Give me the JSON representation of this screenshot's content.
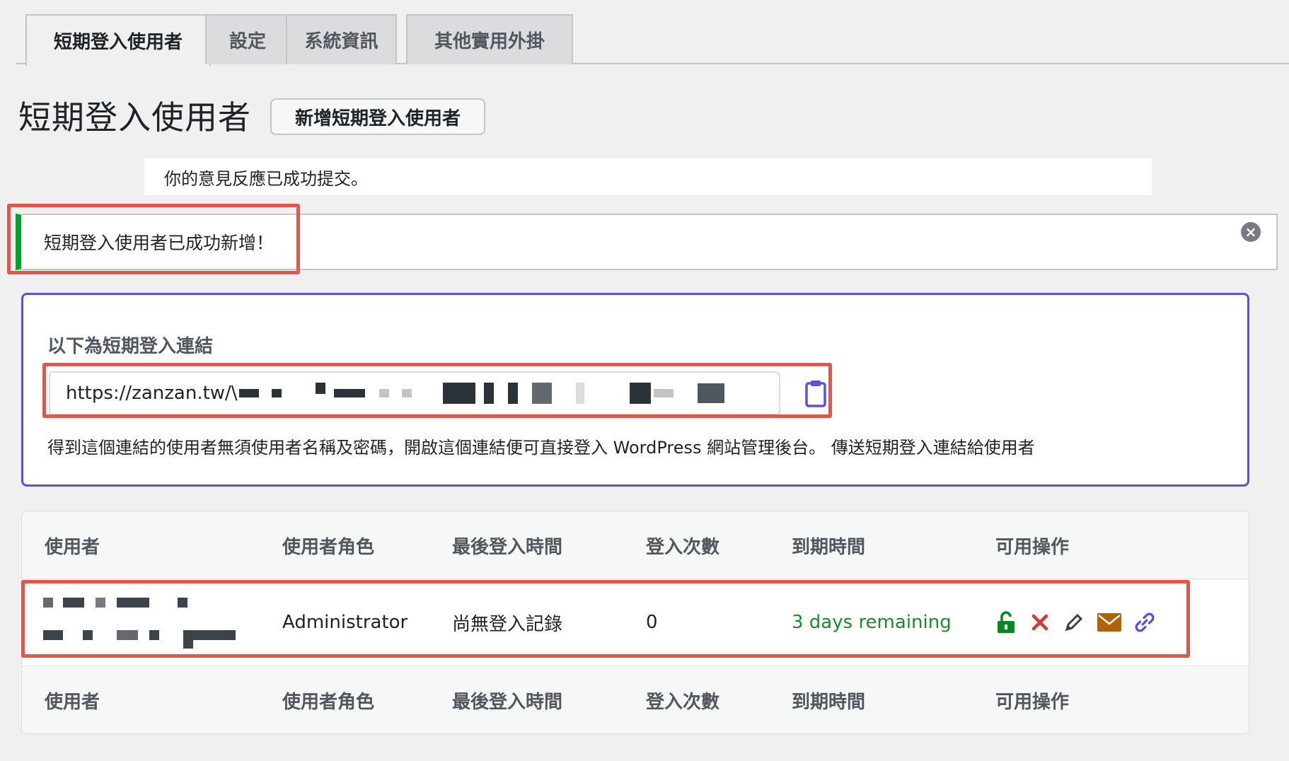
{
  "tabs": [
    {
      "label": "短期登入使用者",
      "active": true
    },
    {
      "label": "設定",
      "active": false
    },
    {
      "label": "系統資訊",
      "active": false
    },
    {
      "label": "其他實用外掛",
      "active": false
    }
  ],
  "header": {
    "title": "短期登入使用者",
    "add_button_label": "新增短期登入使用者"
  },
  "notices": {
    "feedback": "你的意見反應已成功提交。",
    "success": "短期登入使用者已成功新增！"
  },
  "link_box": {
    "caption": "以下為短期登入連結",
    "url_visible": "https://zanzan.tw/\\",
    "description": "得到這個連結的使用者無須使用者名稱及密碼，開啟這個連結便可直接登入 WordPress 網站管理後台。 傳送短期登入連結給使用者"
  },
  "table": {
    "columns": [
      "使用者",
      "使用者角色",
      "最後登入時間",
      "登入次數",
      "到期時間",
      "可用操作"
    ],
    "rows": [
      {
        "role": "Administrator",
        "last_login": "尚無登入記錄",
        "login_count": "0",
        "expiry": "3 days remaining",
        "actions": [
          "unlock-icon",
          "delete-icon",
          "edit-icon",
          "email-icon",
          "link-icon"
        ]
      }
    ]
  },
  "colors": {
    "accent_border": "#5b51d8",
    "success": "#00a32a",
    "highlight": "#e2574c",
    "expiry_text": "#1a8a2e"
  }
}
